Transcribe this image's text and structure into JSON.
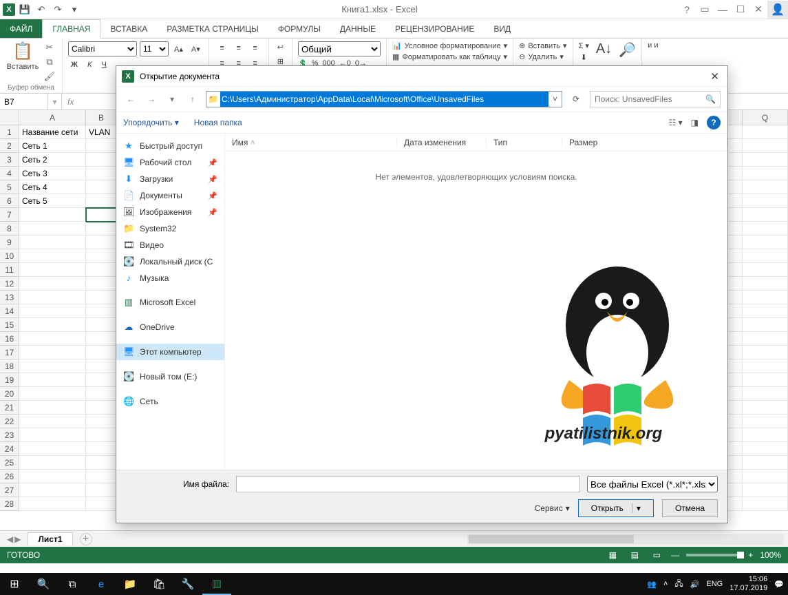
{
  "window": {
    "title": "Книга1.xlsx - Excel"
  },
  "qat": {
    "save": "💾",
    "undo": "↶",
    "redo": "↷",
    "more": "▾"
  },
  "tabs": {
    "file": "ФАЙЛ",
    "home": "ГЛАВНАЯ",
    "insert": "ВСТАВКА",
    "layout": "РАЗМЕТКА СТРАНИЦЫ",
    "formulas": "ФОРМУЛЫ",
    "data": "ДАННЫЕ",
    "review": "РЕЦЕНЗИРОВАНИЕ",
    "view": "ВИД"
  },
  "ribbon": {
    "clipboard": {
      "label": "Буфер обмена",
      "paste": "Вставить"
    },
    "font": {
      "name": "Calibri",
      "size": "11",
      "bold": "Ж",
      "italic": "К",
      "underline": "Ч"
    },
    "number": {
      "general": "Общий"
    },
    "styles": {
      "cond": "Условное форматирование",
      "table": "Форматировать как таблицу"
    },
    "cells": {
      "insert": "Вставить",
      "delete": "Удалить"
    },
    "editing_trunc": "и и"
  },
  "namebox": "B7",
  "columns": [
    "A",
    "B",
    "Q"
  ],
  "col_widths": {
    "A": 97,
    "B": 45,
    "Q": 66
  },
  "rows": [
    {
      "n": 1,
      "A": "Название сети",
      "B": "VLAN"
    },
    {
      "n": 2,
      "A": "Сеть 1",
      "B": ""
    },
    {
      "n": 3,
      "A": "Сеть 2",
      "B": ""
    },
    {
      "n": 4,
      "A": "Сеть 3",
      "B": ""
    },
    {
      "n": 5,
      "A": "Сеть 4",
      "B": ""
    },
    {
      "n": 6,
      "A": "Сеть 5",
      "B": ""
    },
    {
      "n": 7,
      "A": "",
      "B": ""
    },
    {
      "n": 8
    },
    {
      "n": 9
    },
    {
      "n": 10
    },
    {
      "n": 11
    },
    {
      "n": 12
    },
    {
      "n": 13
    },
    {
      "n": 14
    },
    {
      "n": 15
    },
    {
      "n": 16
    },
    {
      "n": 17
    },
    {
      "n": 18
    },
    {
      "n": 19
    },
    {
      "n": 20
    },
    {
      "n": 21
    },
    {
      "n": 22
    },
    {
      "n": 23
    },
    {
      "n": 24
    },
    {
      "n": 25
    },
    {
      "n": 26
    },
    {
      "n": 27
    },
    {
      "n": 28
    }
  ],
  "sheet_tab": "Лист1",
  "status": {
    "ready": "ГОТОВО",
    "zoom": "100%"
  },
  "dialog": {
    "title": "Открытие документа",
    "path": "C:\\Users\\Администратор\\AppData\\Local\\Microsoft\\Office\\UnsavedFiles",
    "search_placeholder": "Поиск: UnsavedFiles",
    "organize": "Упорядочить",
    "new_folder": "Новая папка",
    "nav": {
      "quick": "Быстрый доступ",
      "desktop": "Рабочий стол",
      "downloads": "Загрузки",
      "documents": "Документы",
      "pictures": "Изображения",
      "system32": "System32",
      "video": "Видео",
      "localdisk": "Локальный диск (C",
      "music": "Музыка",
      "excel": "Microsoft Excel",
      "onedrive": "OneDrive",
      "thispc": "Этот компьютер",
      "newvol": "Новый том (E:)",
      "network": "Сеть"
    },
    "cols": {
      "name": "Имя",
      "date": "Дата изменения",
      "type": "Тип",
      "size": "Размер"
    },
    "empty": "Нет элементов, удовлетворяющих условиям поиска.",
    "filename_label": "Имя файла:",
    "filter": "Все файлы Excel (*.xl*;*.xlsx;*.xl",
    "service": "Сервис",
    "open": "Открыть",
    "cancel": "Отмена",
    "watermark": "pyatilistnik.org"
  },
  "taskbar": {
    "lang": "ENG",
    "time": "15:06",
    "date": "17.07.2019"
  }
}
